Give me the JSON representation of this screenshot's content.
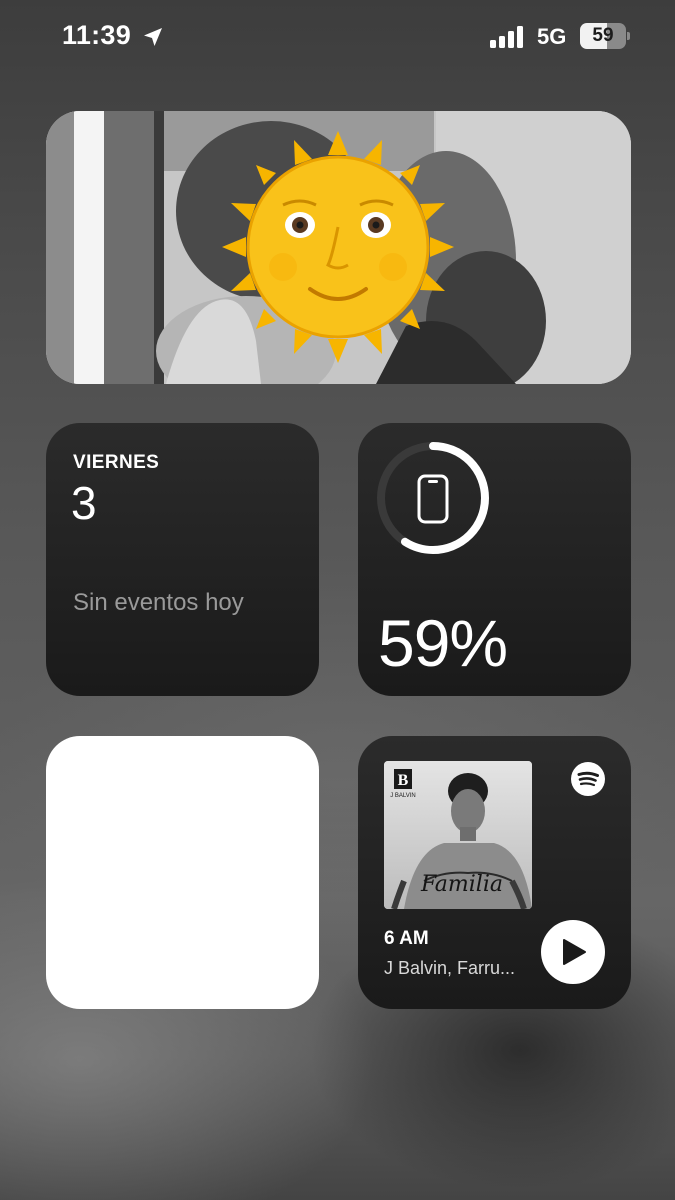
{
  "status_bar": {
    "time": "11:39",
    "location_icon": "location-arrow-icon",
    "signal_icon": "cellular-signal-icon",
    "network": "5G",
    "battery_level": "59"
  },
  "photo_widget": {
    "description_icon": "sun-face-emoji",
    "style": "grayscale"
  },
  "calendar_widget": {
    "day_name": "VIERNES",
    "date": "3",
    "events_text": "Sin eventos hoy"
  },
  "battery_widget": {
    "device_icon": "iphone-icon",
    "percent_text": "59%",
    "level_fraction": 0.59
  },
  "blank_widget": {},
  "spotify_widget": {
    "logo_icon": "spotify-icon",
    "album_title_art": "Familia",
    "album_artist_art": "J BALVIN",
    "track_title": "6 AM",
    "track_artist": "J Balvin, Farru...",
    "play_icon": "play-icon"
  },
  "colors": {
    "widget_dark": "#1e1e1e",
    "ring_track": "#3a3a3a",
    "ring_fill": "#ffffff",
    "secondary_text": "#9a9a9a"
  }
}
